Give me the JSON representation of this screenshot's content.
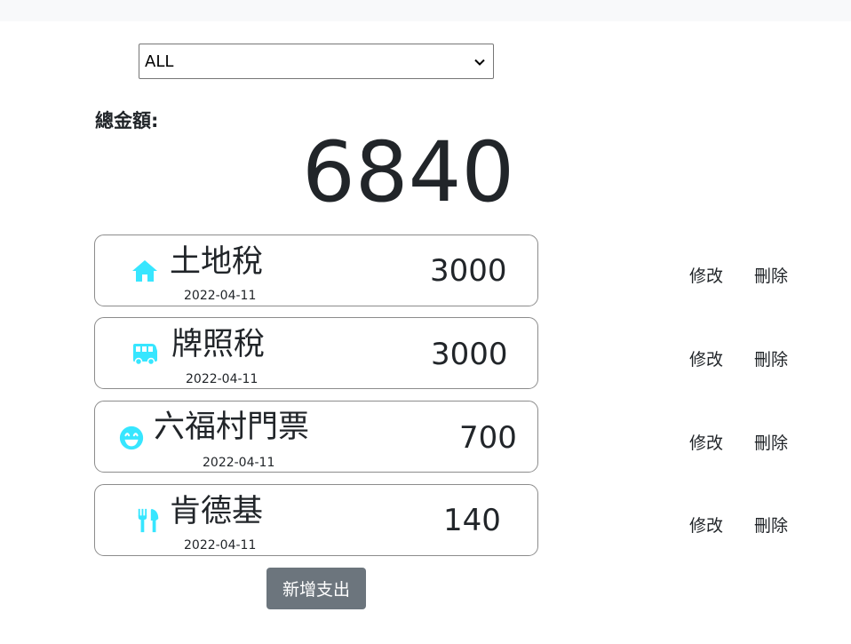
{
  "filter": {
    "selected": "ALL"
  },
  "total": {
    "label": "總金額:",
    "value": "6840"
  },
  "colors": {
    "icon": "#37e6ff",
    "button": "#6c757d"
  },
  "items": [
    {
      "name": "土地稅",
      "date": "2022-04-11",
      "amount": "3000",
      "icon": "home-icon",
      "edit_label": "修改",
      "delete_label": "刪除"
    },
    {
      "name": "牌照稅",
      "date": "2022-04-11",
      "amount": "3000",
      "icon": "bus-icon",
      "edit_label": "修改",
      "delete_label": "刪除"
    },
    {
      "name": "六福村門票",
      "date": "2022-04-11",
      "amount": "700",
      "icon": "smile-icon",
      "edit_label": "修改",
      "delete_label": "刪除"
    },
    {
      "name": "肯德基",
      "date": "2022-04-11",
      "amount": "140",
      "icon": "utensils-icon",
      "edit_label": "修改",
      "delete_label": "刪除"
    }
  ],
  "add_button": {
    "label": "新增支出"
  }
}
